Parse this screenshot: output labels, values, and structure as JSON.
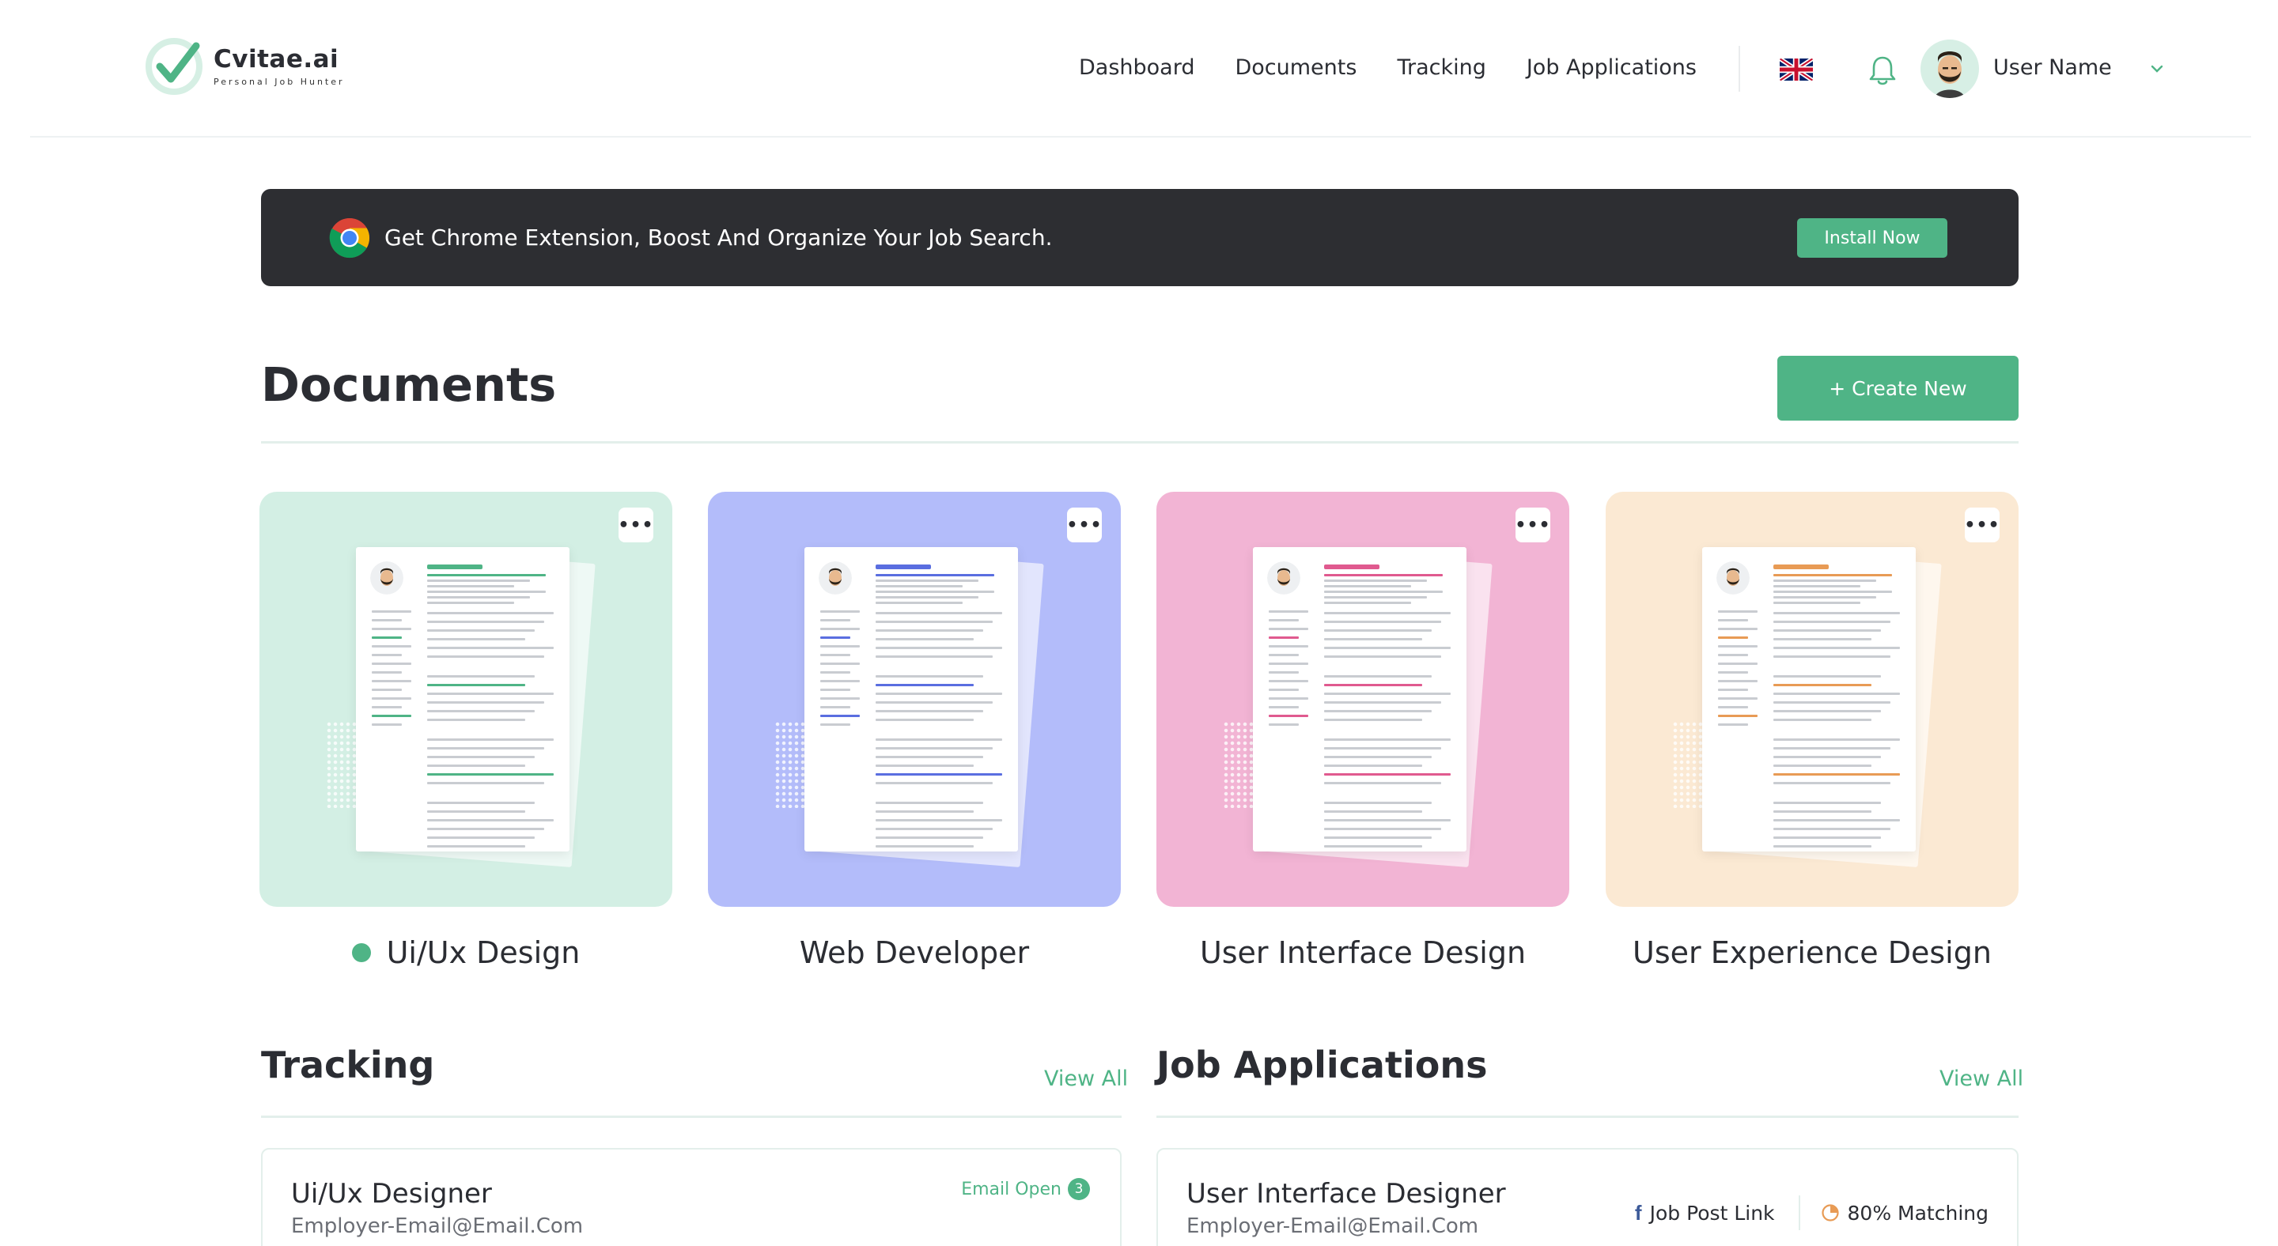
{
  "header": {
    "logo_name": "Cvitae.ai",
    "logo_tagline": "Personal Job Hunter",
    "nav": [
      "Dashboard",
      "Documents",
      "Tracking",
      "Job Applications"
    ],
    "user_name": "User Name",
    "icons": {
      "language": "uk-flag-icon",
      "notifications": "bell-icon",
      "menu": "chevron-down-icon"
    }
  },
  "banner": {
    "text": "Get Chrome Extension, Boost And Organize Your Job Search.",
    "button": "Install Now",
    "icon": "chrome-icon"
  },
  "documents": {
    "title": "Documents",
    "create_button": "+ Create New",
    "items": [
      {
        "label": "Ui/Ux Design",
        "color": "#d3efe4",
        "accent": "#4fb486",
        "active": true
      },
      {
        "label": "Web Developer",
        "color": "#b3bcfa",
        "accent": "#5a6ee0",
        "active": false
      },
      {
        "label": "User Interface Design",
        "color": "#f2b4d4",
        "accent": "#e05a8f",
        "active": false
      },
      {
        "label": "User Experience Design",
        "color": "#fbe9d3",
        "accent": "#e89b55",
        "active": false
      }
    ]
  },
  "tracking": {
    "title": "Tracking",
    "view_all": "View All",
    "items": [
      {
        "title": "Ui/Ux Designer",
        "email": "Employer-Email@Email.Com",
        "status": "Email Open",
        "count": "3"
      }
    ]
  },
  "job_applications": {
    "title": "Job Applications",
    "view_all": "View All",
    "items": [
      {
        "title": "User Interface Designer",
        "email": "Employer-Email@Email.Com",
        "link_label": "Job Post Link",
        "matching": "80% Matching"
      }
    ]
  },
  "colors": {
    "brand": "#4fb486",
    "dark": "#2d2e32",
    "text": "#2b2d33"
  }
}
